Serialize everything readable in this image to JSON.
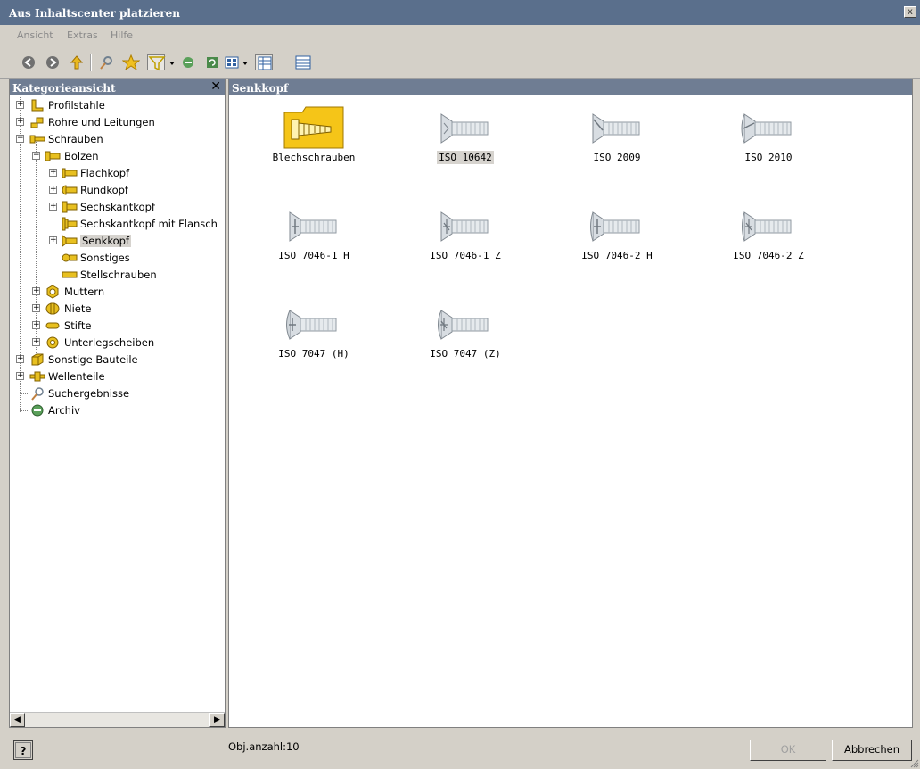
{
  "window": {
    "title": "Aus Inhaltscenter platzieren",
    "close_glyph": "x"
  },
  "menu": {
    "items": [
      "Ansicht",
      "Extras",
      "Hilfe"
    ]
  },
  "toolbar": {
    "icons": [
      "back-icon",
      "forward-icon",
      "up-icon",
      "search-icon",
      "favorites-icon",
      "filter-icon",
      "dropdown-arrow-icon",
      "archive-icon",
      "refresh-icon",
      "view-icon",
      "dropdown-arrow-icon",
      "tree-view-icon",
      "table-view-icon"
    ]
  },
  "left_panel": {
    "title": "Kategorieansicht",
    "close_glyph": "✕",
    "tree": [
      {
        "label": "Profilstahle"
      },
      {
        "label": "Rohre und Leitungen"
      },
      {
        "label": "Schrauben"
      },
      {
        "label": "Bolzen"
      },
      {
        "label": "Flachkopf"
      },
      {
        "label": "Rundkopf"
      },
      {
        "label": "Sechskantkopf"
      },
      {
        "label": "Sechskantkopf mit Flansch"
      },
      {
        "label": "Senkkopf"
      },
      {
        "label": "Sonstiges"
      },
      {
        "label": "Stellschrauben"
      },
      {
        "label": "Muttern"
      },
      {
        "label": "Niete"
      },
      {
        "label": "Stifte"
      },
      {
        "label": "Unterlegscheiben"
      },
      {
        "label": "Sonstige Bauteile"
      },
      {
        "label": "Wellenteile"
      },
      {
        "label": "Suchergebnisse"
      },
      {
        "label": "Archiv"
      }
    ],
    "scroll_left": "◀",
    "scroll_right": "▶"
  },
  "right_panel": {
    "title": "Senkkopf",
    "items": [
      {
        "label": "Blechschrauben",
        "type": "folder"
      },
      {
        "label": "ISO 10642",
        "type": "screw",
        "selected": true
      },
      {
        "label": "ISO 2009",
        "type": "screw"
      },
      {
        "label": "ISO 2010",
        "type": "screw"
      },
      {
        "label": "ISO 7046-1  H",
        "type": "screw"
      },
      {
        "label": "ISO 7046-1  Z",
        "type": "screw"
      },
      {
        "label": "ISO 7046-2 H",
        "type": "screw"
      },
      {
        "label": "ISO 7046-2 Z",
        "type": "screw"
      },
      {
        "label": "ISO 7047 (H)",
        "type": "screw"
      },
      {
        "label": "ISO 7047 (Z)",
        "type": "screw"
      }
    ]
  },
  "status": {
    "help_label": "?",
    "object_count": "Obj.anzahl:10",
    "ok_label": "OK",
    "cancel_label": "Abbrechen"
  },
  "colors": {
    "title_bar": "#5a6f8c",
    "panel_header": "#6f7d93",
    "dialog_bg": "#d4d0c8",
    "selection": "#d6d3ce"
  }
}
